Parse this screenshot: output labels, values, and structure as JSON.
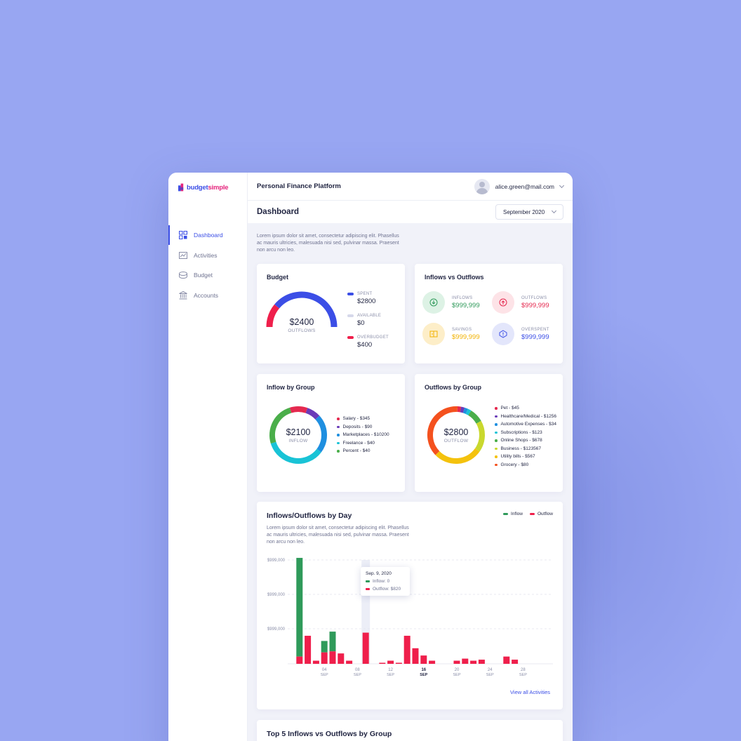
{
  "app": {
    "logo_part1": "budget",
    "logo_part2": "simple",
    "title": "Personal Finance Platform",
    "user_email": "alice.green@mail.com"
  },
  "sidebar": {
    "items": [
      {
        "label": "Dashboard",
        "icon": "dashboard-icon",
        "active": true
      },
      {
        "label": "Activities",
        "icon": "activities-icon",
        "active": false
      },
      {
        "label": "Budget",
        "icon": "budget-icon",
        "active": false
      },
      {
        "label": "Accounts",
        "icon": "accounts-icon",
        "active": false
      }
    ]
  },
  "page": {
    "title": "Dashboard",
    "month": "September 2020",
    "intro": "Lorem ipsum dolor sit amet, consectetur adipiscing elit. Phasellus ac mauris ultricies, malesuada nisi sed, pulvinar massa. Praesent non arcu non leo."
  },
  "budget": {
    "title": "Budget",
    "center_value": "$2400",
    "center_label": "OUTFLOWS",
    "gauge_fractions": {
      "spent": 0.78,
      "overbudget": 0.22
    },
    "legend": [
      {
        "label": "SPENT",
        "value": "$2800",
        "color": "#3b4ee6"
      },
      {
        "label": "AVAILABLE",
        "value": "$0",
        "color": "#d6d8ea"
      },
      {
        "label": "OVERBUDGET",
        "value": "$400",
        "color": "#ef1f4b"
      }
    ]
  },
  "inout": {
    "title": "Inflows vs Outflows",
    "items": [
      {
        "label": "INFLOWS",
        "value": "$999,999",
        "color": "#2f9a5a",
        "bg": "#ddf2e5",
        "icon": "arrow-down-icon"
      },
      {
        "label": "OUTFLOWS",
        "value": "$999,999",
        "color": "#e5294f",
        "bg": "#fde3e7",
        "icon": "arrow-up-icon"
      },
      {
        "label": "SAVINGS",
        "value": "$999,999",
        "color": "#f2b200",
        "bg": "#fdeec8",
        "icon": "savings-icon"
      },
      {
        "label": "OVERSPENT",
        "value": "$999,999",
        "color": "#3b4ee6",
        "bg": "#e3e6fb",
        "icon": "alert-icon"
      }
    ]
  },
  "inflow_group": {
    "title": "Inflow by Group",
    "center_value": "$2100",
    "center_label": "INFLOW",
    "items": [
      {
        "label": "Salary - $345",
        "color": "#e5294f",
        "share": 0.1
      },
      {
        "label": "Deposits - $90",
        "color": "#6a3bb8",
        "share": 0.08
      },
      {
        "label": "Marketplaces - $10200",
        "color": "#1f8fe0",
        "share": 0.22
      },
      {
        "label": "Freelance - $40",
        "color": "#19c3d6",
        "share": 0.35
      },
      {
        "label": "Percent - $40",
        "color": "#4aae4a",
        "share": 0.25
      }
    ]
  },
  "outflow_group": {
    "title": "Outflows by Group",
    "center_value": "$2800",
    "center_label": "OUTFLOW",
    "items": [
      {
        "label": "Pet - $45",
        "color": "#e5294f",
        "share": 0.02
      },
      {
        "label": "Healthcare/Medical - $1256",
        "color": "#6a3bb8",
        "share": 0.02
      },
      {
        "label": "Automotive Expenses - $34",
        "color": "#1f8fe0",
        "share": 0.02
      },
      {
        "label": "Subscriptions - $123",
        "color": "#19c3d6",
        "share": 0.02
      },
      {
        "label": "Online Shops - $678",
        "color": "#4aae4a",
        "share": 0.08
      },
      {
        "label": "Business - $123567",
        "color": "#c9d82e",
        "share": 0.18
      },
      {
        "label": "Utility bills - $567",
        "color": "#f4c20d",
        "share": 0.28
      },
      {
        "label": "Grocery - $80",
        "color": "#f4511e",
        "share": 0.38
      }
    ]
  },
  "daily": {
    "title": "Inflows/Outflows by Day",
    "description": "Lorem ipsum dolor sit amet, consectetur adipiscing elit. Phasellus ac mauris ultricies, malesuada nisi sed, pulvinar massa. Praesent non arcu non leo.",
    "legend": [
      {
        "label": "Inflow",
        "color": "#2f9a5a"
      },
      {
        "label": "Outflow",
        "color": "#ef1f4b"
      }
    ],
    "view_all": "View all Activities",
    "tooltip": {
      "date": "Sep. 9, 2020",
      "inflow": "Inflow:  0",
      "outflow": "Outflow:  $820"
    }
  },
  "chart_data": {
    "type": "bar",
    "y_ticks": [
      "$999,000",
      "$999,000",
      "$999,000"
    ],
    "x_ticks": [
      {
        "day": "04",
        "month": "SEP",
        "bold": false
      },
      {
        "day": "08",
        "month": "SEP",
        "bold": false
      },
      {
        "day": "12",
        "month": "SEP",
        "bold": false
      },
      {
        "day": "16",
        "month": "SEP",
        "bold": true
      },
      {
        "day": "20",
        "month": "SEP",
        "bold": false
      },
      {
        "day": "24",
        "month": "SEP",
        "bold": false
      },
      {
        "day": "28",
        "month": "SEP",
        "bold": false
      }
    ],
    "ylim": [
      0,
      100
    ],
    "highlight_day": 9,
    "series": [
      {
        "name": "Inflow",
        "values": [
          [
            1,
            95
          ],
          [
            4,
            11
          ],
          [
            5,
            19
          ]
        ]
      },
      {
        "name": "Outflow",
        "values": [
          [
            1,
            7
          ],
          [
            2,
            27
          ],
          [
            3,
            3
          ],
          [
            4,
            11
          ],
          [
            5,
            12
          ],
          [
            6,
            10
          ],
          [
            7,
            3
          ],
          [
            9,
            30
          ],
          [
            11,
            1
          ],
          [
            12,
            3
          ],
          [
            13,
            1
          ],
          [
            14,
            27
          ],
          [
            15,
            15
          ],
          [
            16,
            8
          ],
          [
            17,
            3
          ],
          [
            20,
            3
          ],
          [
            21,
            5
          ],
          [
            22,
            3
          ],
          [
            23,
            4
          ],
          [
            26,
            7
          ],
          [
            27,
            4
          ]
        ]
      }
    ]
  },
  "bottom": {
    "title": "Top 5 Inflows vs Outflows by Group"
  }
}
